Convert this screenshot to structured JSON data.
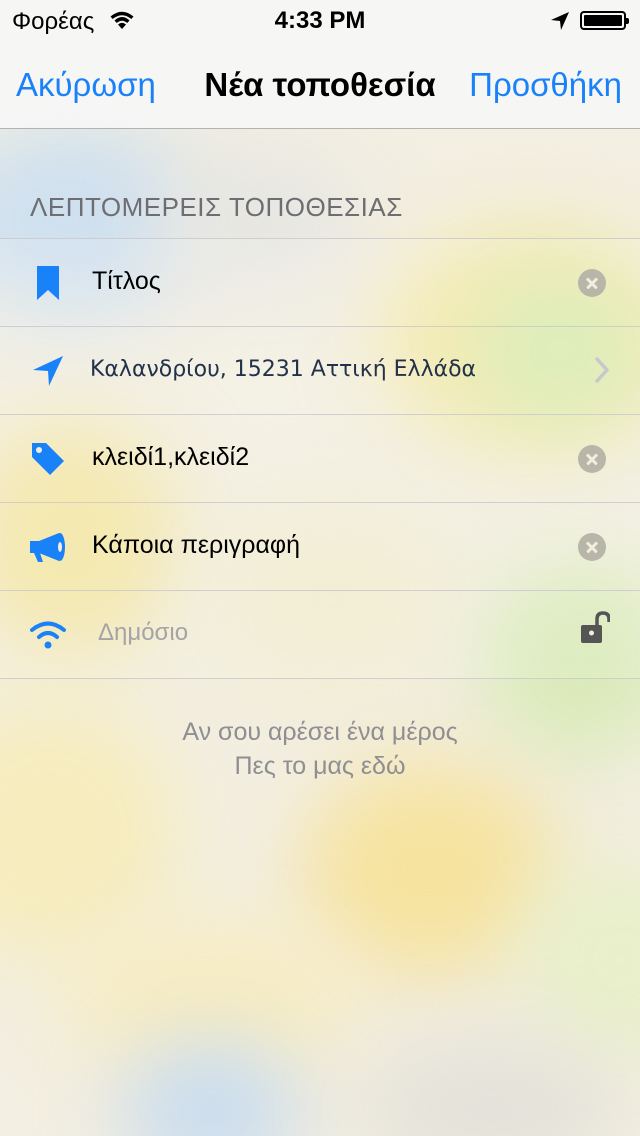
{
  "status_bar": {
    "carrier": "Φορέας",
    "time": "4:33 PM",
    "icons": [
      "wifi-icon",
      "location-arrow-icon",
      "battery-icon"
    ]
  },
  "nav": {
    "cancel_label": "Ακύρωση",
    "title": "Νέα τοποθεσία",
    "add_label": "Προσθήκη"
  },
  "section": {
    "header": "ΛΕΠΤΟΜΕΡΕΙΣ ΤΟΠΟΘΕΣΙΑΣ"
  },
  "fields": {
    "title": {
      "value": "Τίτλος",
      "icon": "bookmark-icon"
    },
    "address": {
      "value": "Καλανδρίου, 15231 Αττική Ελλάδα",
      "icon": "location-arrow-icon"
    },
    "tags": {
      "value": "κλειδί1,κλειδί2",
      "icon": "tag-icon"
    },
    "description": {
      "value": "Κάποια περιγραφή",
      "icon": "megaphone-icon"
    },
    "visibility": {
      "placeholder": "Δημόσιο",
      "icon": "wifi-broadcast-icon"
    }
  },
  "footer": {
    "line1": "Αν σου αρέσει ένα μέρος",
    "line2": "Πες το μας εδώ"
  },
  "colors": {
    "accent": "#1a82f8",
    "secondary_text": "#8e8e93",
    "header_text": "#6d6d72"
  }
}
